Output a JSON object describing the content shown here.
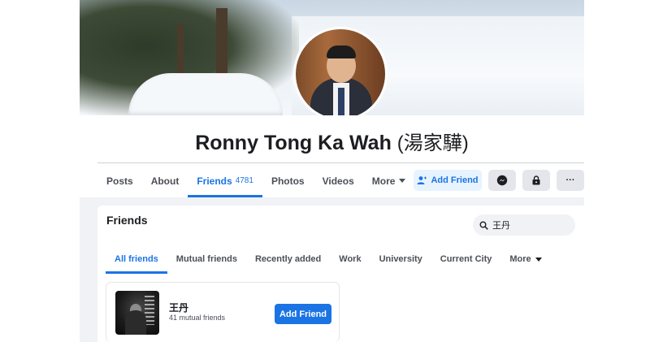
{
  "profile": {
    "name": "Ronny Tong Ka Wah",
    "name_chinese": "(湯家驊)"
  },
  "nav_tabs": [
    {
      "label": "Posts"
    },
    {
      "label": "About"
    },
    {
      "label": "Friends",
      "count": "4781",
      "active": true
    },
    {
      "label": "Photos"
    },
    {
      "label": "Videos"
    },
    {
      "label": "More"
    }
  ],
  "actions": {
    "add_friend_label": "Add Friend",
    "more_label": "···"
  },
  "friends_panel": {
    "title": "Friends",
    "search_value": "王丹",
    "subtabs": [
      {
        "label": "All friends",
        "active": true
      },
      {
        "label": "Mutual friends"
      },
      {
        "label": "Recently added"
      },
      {
        "label": "Work"
      },
      {
        "label": "University"
      },
      {
        "label": "Current City"
      },
      {
        "label": "More"
      }
    ],
    "result": {
      "name": "王丹",
      "mutual": "41 mutual friends",
      "button_label": "Add Friend"
    }
  },
  "colors": {
    "accent": "#1b74e4",
    "accent_light": "#e7f3ff",
    "background": "#f0f2f5"
  }
}
